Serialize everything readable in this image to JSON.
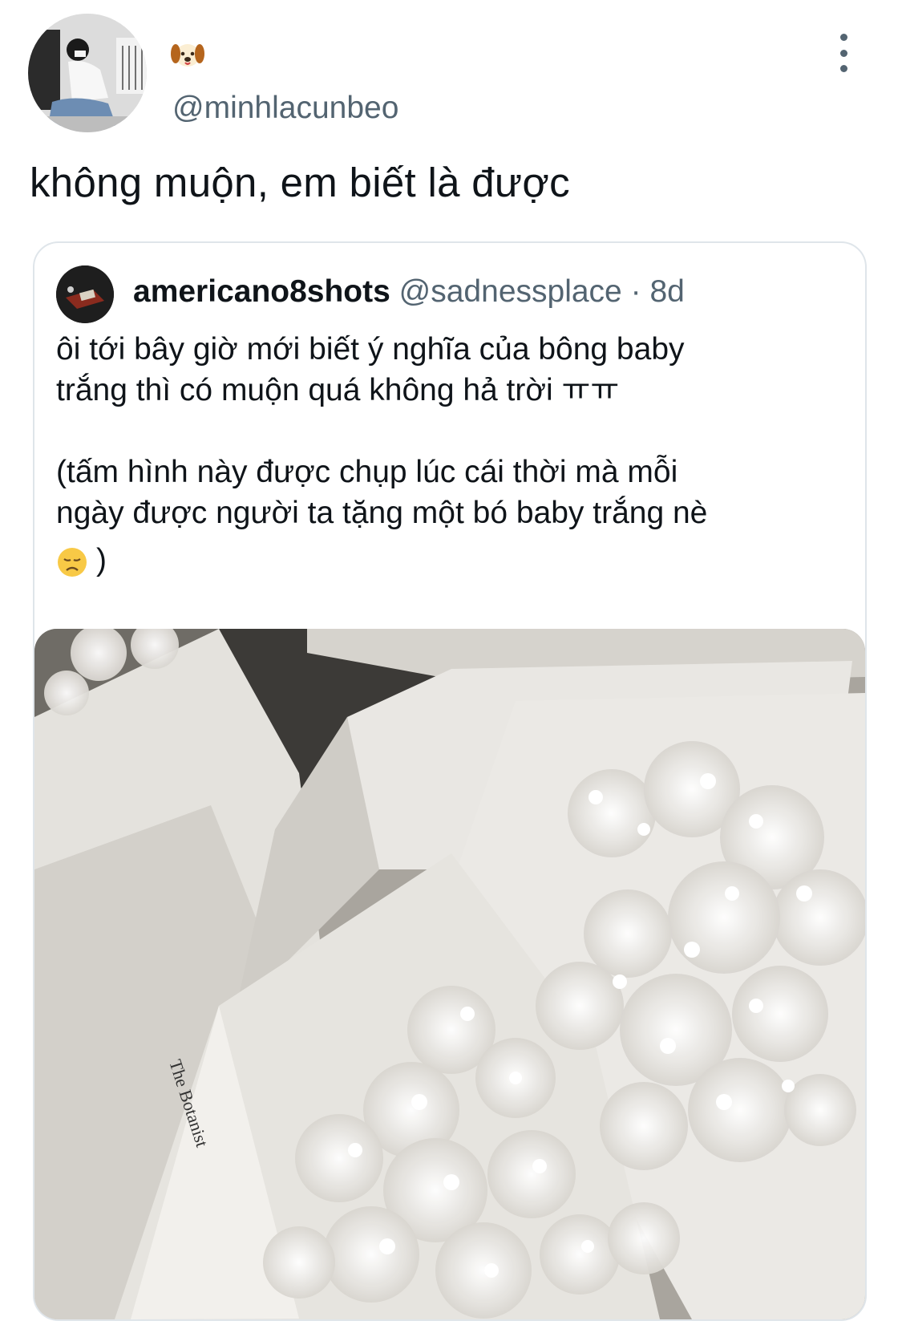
{
  "tweet": {
    "author_name_emoji": "dog-face-emoji",
    "handle": "@minhlacunbeo",
    "text": "không muộn, em biết là được"
  },
  "quote": {
    "display_name": "americano8shots",
    "handle": "@sadnessplace",
    "separator": "·",
    "time": "8d",
    "line1": "ôi tới bây giờ mới biết ý nghĩa của bông baby",
    "line2": "trắng thì có muộn quá không hả trời ㅠㅠ",
    "line3": "(tấm hình này được chụp lúc cái thời mà mỗi",
    "line4": "ngày được người ta tặng một bó baby trắng nè",
    "line5_emoji": "disappointed-face-emoji",
    "line5_text": ")",
    "photo_text": "The Botanist"
  },
  "colors": {
    "text": "#0f1419",
    "secondary": "#536471",
    "border": "#dfe5ea"
  }
}
